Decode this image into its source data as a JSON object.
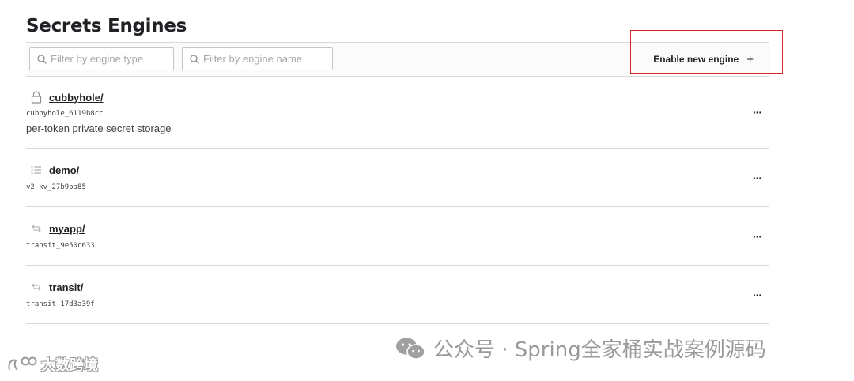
{
  "header": {
    "title": "Secrets Engines"
  },
  "toolbar": {
    "filter_type_placeholder": "Filter by engine type",
    "filter_name_placeholder": "Filter by engine name",
    "enable_button_label": "Enable new engine",
    "enable_button_icon": "+"
  },
  "engines": [
    {
      "path": "cubbyhole/",
      "icon": "lock-icon",
      "accessor": "cubbyhole_6119b8cc",
      "description": "per-token private secret storage",
      "menu": "···"
    },
    {
      "path": "demo/",
      "icon": "list-icon",
      "accessor": "v2 kv_27b9ba85",
      "description": "",
      "menu": "···"
    },
    {
      "path": "myapp/",
      "icon": "swap-icon",
      "accessor": "transit_9e50c633",
      "description": "",
      "menu": "···"
    },
    {
      "path": "transit/",
      "icon": "swap-icon",
      "accessor": "transit_17d3a39f",
      "description": "",
      "menu": "···"
    }
  ],
  "watermarks": {
    "right": "公众号 · Spring全家桶实战案例源码",
    "left": "大数跨境"
  },
  "colors": {
    "highlight": "#d8262b",
    "border": "#d7d9dc",
    "text": "#1f2124"
  }
}
